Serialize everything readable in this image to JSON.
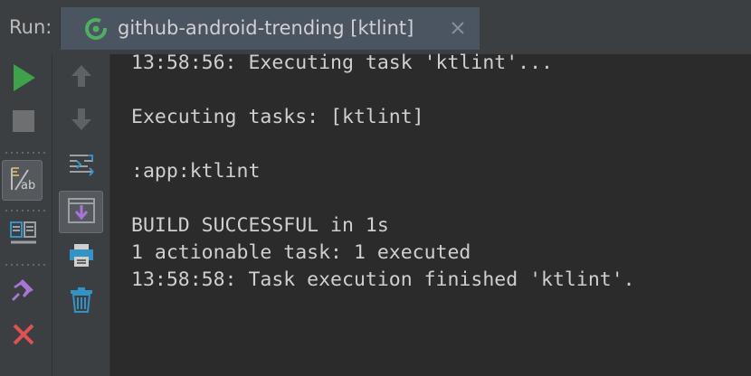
{
  "run_panel": {
    "label": "Run:",
    "tab": {
      "title": "github-android-trending [ktlint]",
      "icon": "gradle-run-icon",
      "close_icon": "close-icon"
    }
  },
  "toolbar_left": {
    "buttons": [
      "rerun-icon",
      "stop-icon",
      "soft-wrap-icon",
      "layout-icon",
      "pin-icon",
      "close-icon"
    ]
  },
  "toolbar_right": {
    "buttons": [
      "up-arrow-icon",
      "down-arrow-icon",
      "filter-icon",
      "scroll-to-end-icon",
      "print-icon",
      "trash-icon"
    ]
  },
  "console": {
    "lines": [
      "13:58:56: Executing task 'ktlint'...",
      "",
      "Executing tasks: [ktlint]",
      "",
      ":app:ktlint",
      "",
      "BUILD SUCCESSFUL in 1s",
      "1 actionable task: 1 executed",
      "13:58:58: Task execution finished 'ktlint'."
    ]
  },
  "colors": {
    "background": "#2b2b2b",
    "panel": "#3c3f41",
    "tab_active": "#4b5561",
    "text": "#cfcfcf",
    "run_green": "#3fa14a",
    "stop_red": "#e05252",
    "icon_blue": "#3592c4",
    "purple": "#a675d6"
  }
}
